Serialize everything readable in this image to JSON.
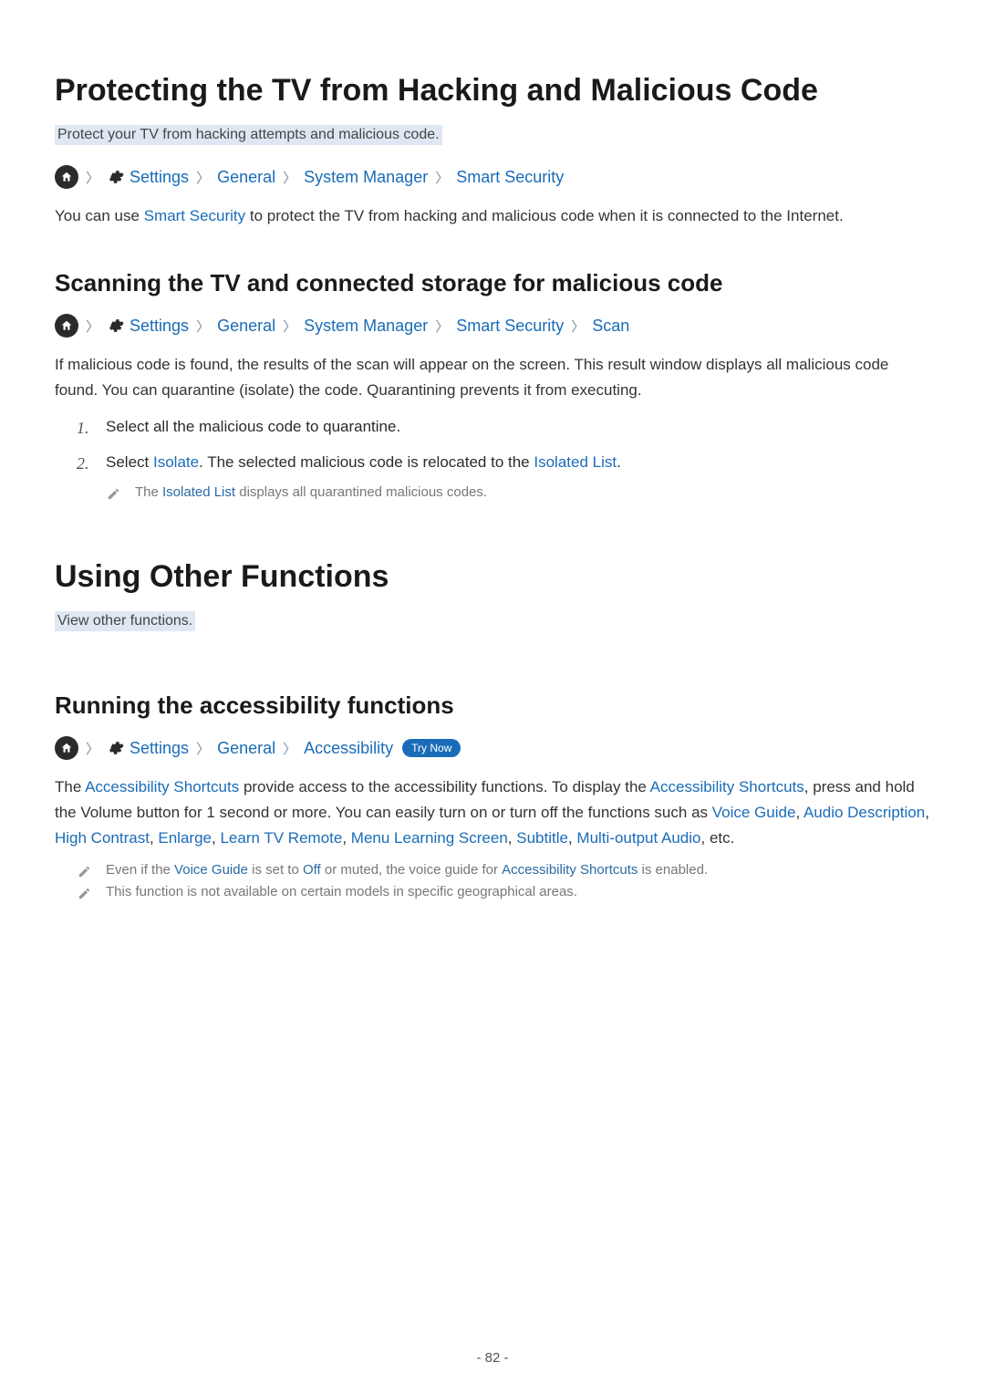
{
  "page_number": "- 82 -",
  "section1": {
    "title": "Protecting the TV from Hacking and Malicious Code",
    "subtitle": "Protect your TV from hacking attempts and malicious code.",
    "breadcrumb": {
      "settings": "Settings",
      "general": "General",
      "system_manager": "System Manager",
      "smart_security": "Smart Security"
    },
    "intro_pre": "You can use ",
    "intro_link": "Smart Security",
    "intro_post": " to protect the TV from hacking and malicious code when it is connected to the Internet."
  },
  "section1b": {
    "heading": "Scanning the TV and connected storage for malicious code",
    "breadcrumb": {
      "settings": "Settings",
      "general": "General",
      "system_manager": "System Manager",
      "smart_security": "Smart Security",
      "scan": "Scan"
    },
    "para": "If malicious code is found, the results of the scan will appear on the screen. This result window displays all malicious code found. You can quarantine (isolate) the code. Quarantining prevents it from executing.",
    "step1": "Select all the malicious code to quarantine.",
    "step2_pre": "Select ",
    "step2_link1": "Isolate",
    "step2_mid": ". The selected malicious code is relocated to the ",
    "step2_link2": "Isolated List",
    "step2_post": ".",
    "note_pre": "The ",
    "note_link": "Isolated List",
    "note_post": " displays all quarantined malicious codes.",
    "num1": "1.",
    "num2": "2."
  },
  "section2": {
    "title": "Using Other Functions",
    "subtitle": "View other functions."
  },
  "section2b": {
    "heading": "Running the accessibility functions",
    "breadcrumb": {
      "settings": "Settings",
      "general": "General",
      "accessibility": "Accessibility"
    },
    "try_now": "Try Now",
    "para_pre": "The ",
    "para_l1": "Accessibility Shortcuts",
    "para_mid1": " provide access to the accessibility functions. To display the ",
    "para_l2": "Accessibility Shortcuts",
    "para_mid2": ", press and hold the Volume button for 1 second or more. You can easily turn on or turn off the functions such as ",
    "para_l3": "Voice Guide",
    "comma": ", ",
    "para_l4": "Audio Description",
    "para_l5": "High Contrast",
    "para_l6": "Enlarge",
    "para_l7": "Learn TV Remote",
    "para_l8": "Menu Learning Screen",
    "para_l9": "Subtitle",
    "para_l10": "Multi-output Audio",
    "para_post": ", etc.",
    "note1_pre": "Even if the ",
    "note1_l1": "Voice Guide",
    "note1_mid1": " is set to ",
    "note1_l2": "Off",
    "note1_mid2": " or muted, the voice guide for ",
    "note1_l3": "Accessibility Shortcuts",
    "note1_post": " is enabled.",
    "note2": "This function is not available on certain models in specific geographical areas."
  }
}
